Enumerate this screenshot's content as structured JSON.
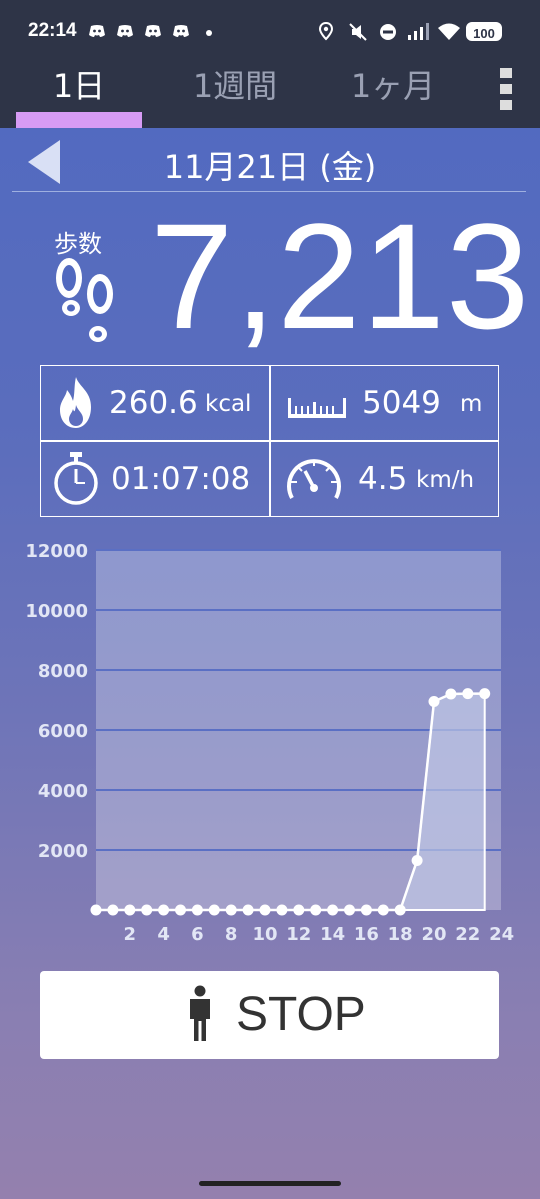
{
  "status_bar": {
    "time": "22:14",
    "battery": "100"
  },
  "tabs": [
    {
      "label": "1日",
      "active": true
    },
    {
      "label": "1週間",
      "active": false
    },
    {
      "label": "1ヶ月",
      "active": false
    }
  ],
  "date": "11月21日 (金)",
  "steps": {
    "label": "歩数",
    "value": "7,213"
  },
  "stats": {
    "calories": {
      "value": "260.6",
      "unit": "kcal",
      "icon": "fire-icon"
    },
    "distance": {
      "value": "5049",
      "unit": "m",
      "icon": "ruler-icon"
    },
    "duration": {
      "value": "01:07:08",
      "icon": "stopwatch-icon"
    },
    "speed": {
      "value": "4.5",
      "unit": "km/h",
      "icon": "speedometer-icon"
    }
  },
  "stop_button": {
    "label": "STOP",
    "icon": "person-icon"
  },
  "colors": {
    "header_bg": "#2e3447",
    "tab_underline": "#d79bf5",
    "chart_area": "#c2c9e6",
    "chart_line": "#ffffff"
  },
  "chart_data": {
    "type": "area",
    "x": [
      0,
      1,
      2,
      3,
      4,
      5,
      6,
      7,
      8,
      9,
      10,
      11,
      12,
      13,
      14,
      15,
      16,
      17,
      18,
      19,
      20,
      21,
      22,
      23
    ],
    "y": [
      0,
      0,
      0,
      0,
      0,
      0,
      0,
      0,
      0,
      0,
      0,
      0,
      0,
      0,
      0,
      0,
      0,
      0,
      0,
      1650,
      6950,
      7200,
      7213,
      7213
    ],
    "xticks": [
      "2",
      "4",
      "6",
      "8",
      "10",
      "12",
      "14",
      "16",
      "18",
      "20",
      "22",
      "24"
    ],
    "yticks": [
      "12000",
      "10000",
      "8000",
      "6000",
      "4000",
      "2000"
    ],
    "xlim": [
      0,
      24
    ],
    "ylim": [
      0,
      12000
    ],
    "grid": true
  }
}
